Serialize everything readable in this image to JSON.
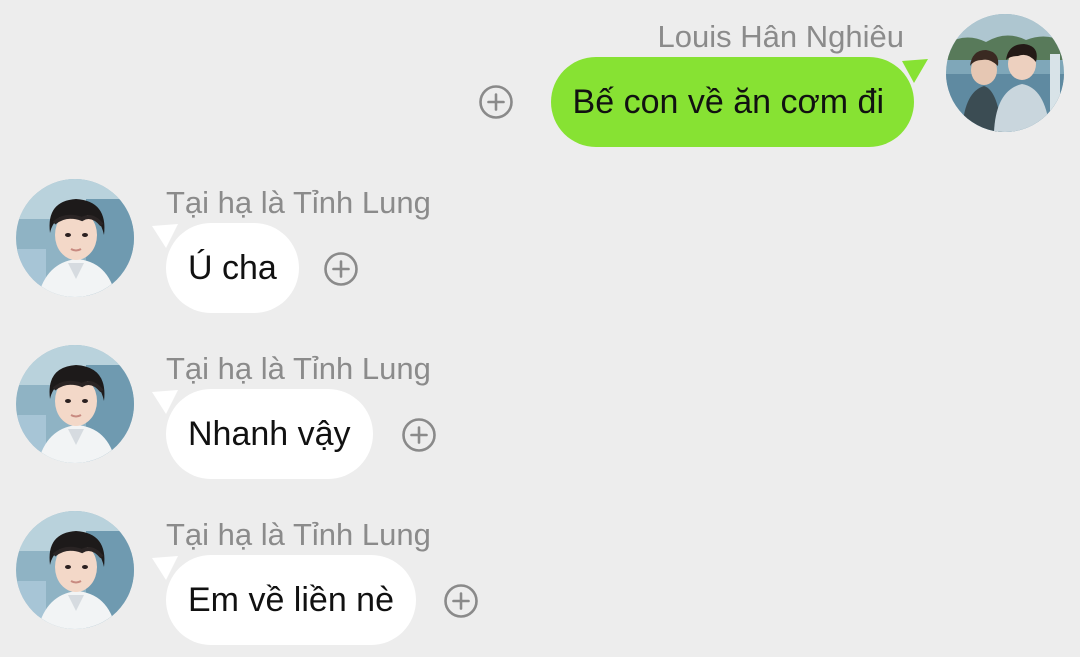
{
  "messages": [
    {
      "direction": "outgoing",
      "sender": "Louis Hân Nghiêu",
      "text": "Bế con về ăn cơm đi",
      "avatar": "user-photo-avatar"
    },
    {
      "direction": "incoming",
      "sender": "Tại hạ là Tỉnh Lung",
      "text": "Ú cha",
      "avatar": "contact-photo-avatar"
    },
    {
      "direction": "incoming",
      "sender": "Tại hạ là Tỉnh Lung",
      "text": "Nhanh vậy",
      "avatar": "contact-photo-avatar"
    },
    {
      "direction": "incoming",
      "sender": "Tại hạ là Tỉnh Lung",
      "text": "Em về liền nè",
      "avatar": "contact-photo-avatar"
    }
  ],
  "icons": {
    "react": "plus-circle-icon"
  },
  "colors": {
    "background": "#ededed",
    "outgoing_bubble": "#87e233",
    "incoming_bubble": "#ffffff",
    "sender_name": "#8b8b8b",
    "message_text": "#111111",
    "react_icon": "#8a8a8a"
  }
}
